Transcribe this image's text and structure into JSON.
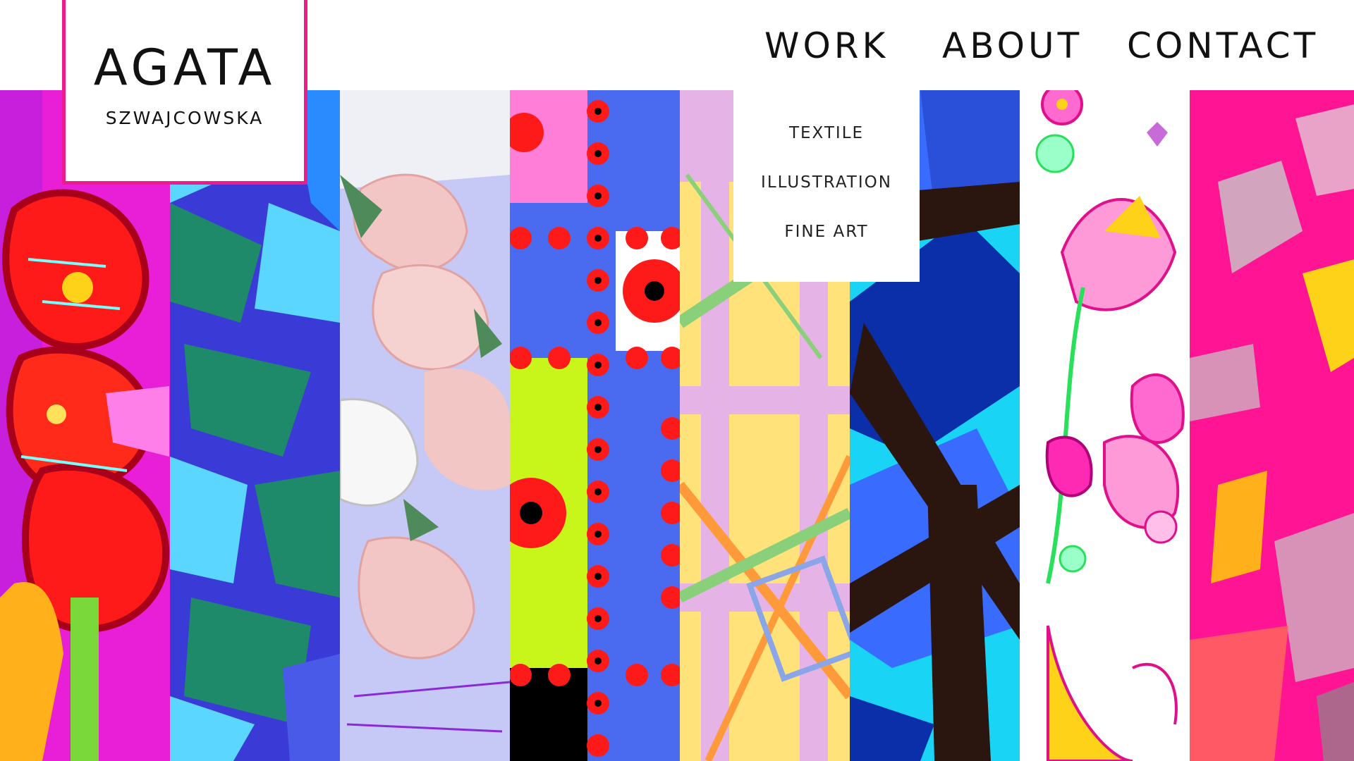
{
  "logo": {
    "name": "AGATA",
    "surname": "SZWAJCOWSKA"
  },
  "nav": {
    "items": [
      {
        "label": "WORK"
      },
      {
        "label": "ABOUT"
      },
      {
        "label": "CONTACT"
      }
    ]
  },
  "work_menu": {
    "items": [
      {
        "label": "TEXTILE"
      },
      {
        "label": "ILLUSTRATION"
      },
      {
        "label": "FINE ART"
      }
    ]
  },
  "gallery": {
    "artworks": [
      {
        "subject": "red poppies on magenta",
        "colors": [
          "#e81fd6",
          "#ff1a1a",
          "#ffd21a",
          "#7ad83a"
        ]
      },
      {
        "subject": "blue and green leaves",
        "colors": [
          "#3a3bd6",
          "#1f8a6a",
          "#5ad6ff"
        ]
      },
      {
        "subject": "pale pink petals",
        "colors": [
          "#c6c8f5",
          "#f2c6c4",
          "#4f8a5a",
          "#f7f7f7"
        ]
      },
      {
        "subject": "red flowers grid",
        "colors": [
          "#4a6bf0",
          "#ff1a1a",
          "#ff7fd8",
          "#c8f51a",
          "#000000"
        ]
      },
      {
        "subject": "pastel geometric lines",
        "colors": [
          "#ffe27a",
          "#e6b3e6",
          "#ff9a3a",
          "#8ad07a"
        ]
      },
      {
        "subject": "blue shards with dark bands",
        "colors": [
          "#19d4f5",
          "#0a2fa8",
          "#2a160e",
          "#3a6bff"
        ]
      },
      {
        "subject": "hand drawn flowers",
        "colors": [
          "#ffffff",
          "#ff2ab3",
          "#28e05a",
          "#ffd21a"
        ]
      },
      {
        "subject": "hot pink abstract brushstrokes",
        "colors": [
          "#ff1493",
          "#c8c8c8",
          "#ffd21a"
        ]
      }
    ]
  }
}
